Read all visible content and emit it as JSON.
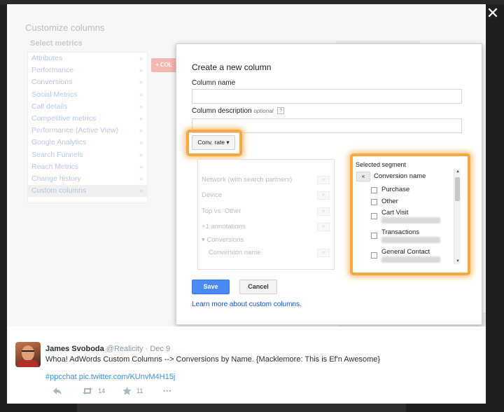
{
  "window": {
    "close_glyph": "✕"
  },
  "background": {
    "title": "Customize columns",
    "select_metrics": "Select metrics",
    "menu_items": [
      "Attributes",
      "Performance",
      "Conversions",
      "Social Metrics",
      "Call details",
      "Competitive metrics",
      "Performance (Active View)",
      "Google Analytics",
      "Search Funnels",
      "Reach Metrics",
      "Change history",
      "Custom columns"
    ],
    "menu_chevron": "»",
    "add_button": "+ COL"
  },
  "dialog": {
    "title": "Create a new column",
    "column_name_label": "Column name",
    "column_name_value": "",
    "description_label": "Column description",
    "optional": "optional",
    "help": "?",
    "description_value": "",
    "conv_button": "Conv. rate ▾",
    "picker_rows": [
      {
        "label": "Network (with search partners)",
        "arrow": "»"
      },
      {
        "label": "Device",
        "arrow": "»"
      },
      {
        "label": "Top vs. Other",
        "arrow": "»"
      },
      {
        "label": "+1 annotations",
        "arrow": "»"
      },
      {
        "label": "▾ Conversions",
        "arrow": ""
      },
      {
        "label": "Conversion name",
        "arrow": "»"
      }
    ],
    "segment": {
      "title": "Selected segment",
      "back": "«",
      "header": "Conversion name",
      "items": [
        "Purchase",
        "Other",
        "Cart Visit",
        "Transactions",
        "General Contact"
      ]
    },
    "save": "Save",
    "cancel": "Cancel",
    "learn_more": "Learn more about custom columns."
  },
  "tweet": {
    "name": "James Svoboda",
    "handle": "@Realicity · Dec 9",
    "text": "Whoa! AdWords Custom Columns --> Conversions by Name.   {Macklemore: This is Ef'n Awesome}",
    "hashtag": "#ppcchat",
    "link": "pic.twitter.com/KUnvM4H15j",
    "retweets": "14",
    "favorites": "11",
    "more": "•••"
  },
  "colors": {
    "highlight": "#f7a940",
    "save_button": "#4a8af4",
    "link": "#1155cc",
    "tweet_link": "#3b94d9"
  }
}
